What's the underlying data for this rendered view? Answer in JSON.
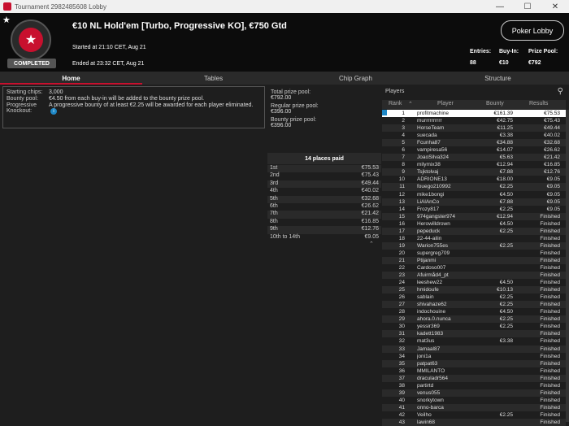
{
  "window": {
    "title": "Tournament 2982485608 Lobby",
    "min": "—",
    "max": "☐",
    "close": "✕"
  },
  "header": {
    "status": "COMPLETED",
    "title": "€10 NL Hold'em [Turbo, Progressive KO], €750 Gtd",
    "started": "Started at 21:10 CET, Aug 21",
    "ended": "Ended at 23:32 CET, Aug 21",
    "lobby_button": "Poker Lobby",
    "stats": [
      {
        "label": "Entries:",
        "value": "88"
      },
      {
        "label": "Buy-In:",
        "value": "€10"
      },
      {
        "label": "Prize Pool:",
        "value": "€792"
      }
    ]
  },
  "tabs": [
    "Home",
    "Tables",
    "Chip Graph",
    "Structure"
  ],
  "info": {
    "starting_chips_label": "Starting chips:",
    "starting_chips": "3,000",
    "bounty_pool_label": "Bounty pool:",
    "bounty_pool": "€4.50 from each buy-in will be added to the bounty prize pool.",
    "progressive_label": "Progressive Knockout:",
    "progressive": "A progressive bounty of at least €2.25 will be awarded for each player eliminated."
  },
  "prizes": {
    "total_label": "Total prize pool:",
    "total": "€792.00",
    "regular_label": "Regular prize pool:",
    "regular": "€396.00",
    "bounty_label": "Bounty prize pool:",
    "bounty": "€396.00",
    "places_header": "14 places paid",
    "places": [
      {
        "place": "1st",
        "amount": "€75.53"
      },
      {
        "place": "2nd",
        "amount": "€75.43"
      },
      {
        "place": "3rd",
        "amount": "€49.44"
      },
      {
        "place": "4th",
        "amount": "€40.02"
      },
      {
        "place": "5th",
        "amount": "€32.68"
      },
      {
        "place": "6th",
        "amount": "€26.62"
      },
      {
        "place": "7th",
        "amount": "€21.42"
      },
      {
        "place": "8th",
        "amount": "€16.85"
      },
      {
        "place": "9th",
        "amount": "€12.76"
      },
      {
        "place": "10th to 14th",
        "amount": "€9.05"
      }
    ]
  },
  "players": {
    "title": "Players",
    "columns": [
      "Rank",
      "Player",
      "Bounty",
      "Results"
    ],
    "rows": [
      [
        "1",
        "profitmachine",
        "€161.39",
        "€75.53"
      ],
      [
        "2",
        "murrrrrrrrrr",
        "€42.75",
        "€75.43"
      ],
      [
        "3",
        "HorseTeam",
        "€11.25",
        "€49.44"
      ],
      [
        "4",
        "suecada",
        "€3.38",
        "€40.02"
      ],
      [
        "5",
        "Fcunha87",
        "€34.88",
        "€32.68"
      ],
      [
        "6",
        "vampiresa56",
        "€14.07",
        "€26.62"
      ],
      [
        "7",
        "JoaoSilva324",
        "€5.63",
        "€21.42"
      ],
      [
        "8",
        "milymix38",
        "€12.94",
        "€16.85"
      ],
      [
        "9",
        "Tsjktolvaj",
        "€7.88",
        "€12.76"
      ],
      [
        "10",
        "ADRIONE13",
        "€18.00",
        "€9.05"
      ],
      [
        "11",
        "fouego210992",
        "€2.25",
        "€9.05"
      ],
      [
        "12",
        "mike1bongi",
        "€4.50",
        "€9.05"
      ],
      [
        "13",
        "LiAlAnCo",
        "€7.88",
        "€9.05"
      ],
      [
        "14",
        "Frozy817",
        "€2.25",
        "€9.05"
      ],
      [
        "15",
        "974gangster974",
        "€12.94",
        "Finished"
      ],
      [
        "16",
        "Herowilldrown",
        "€4.50",
        "Finished"
      ],
      [
        "17",
        "pepeduck",
        "€2.25",
        "Finished"
      ],
      [
        "18",
        "22-44-ailin",
        "",
        "Finished"
      ],
      [
        "19",
        "Warion755es",
        "€2.25",
        "Finished"
      ],
      [
        "20",
        "supergreg709",
        "",
        "Finished"
      ],
      [
        "21",
        "Ptijanmi",
        "",
        "Finished"
      ],
      [
        "22",
        "Cardoso007",
        "",
        "Finished"
      ],
      [
        "23",
        "Afuirmåd4_pt",
        "",
        "Finished"
      ],
      [
        "24",
        "leeshew22",
        "€4.50",
        "Finished"
      ],
      [
        "25",
        "hmidoufe",
        "€10.13",
        "Finished"
      ],
      [
        "26",
        "sablain",
        "€2.25",
        "Finished"
      ],
      [
        "27",
        "shivahaze62",
        "€2.25",
        "Finished"
      ],
      [
        "28",
        "indochouine",
        "€4.50",
        "Finished"
      ],
      [
        "29",
        "ahora.0.nunca",
        "€2.25",
        "Finished"
      ],
      [
        "30",
        "yessir369",
        "€2.25",
        "Finished"
      ],
      [
        "31",
        "kadett1983",
        "",
        "Finished"
      ],
      [
        "32",
        "mat3us",
        "€3.38",
        "Finished"
      ],
      [
        "33",
        "Jamaal87",
        "",
        "Finished"
      ],
      [
        "34",
        "joni1a",
        "",
        "Finished"
      ],
      [
        "35",
        "patpat63",
        "",
        "Finished"
      ],
      [
        "36",
        "MMILANTO",
        "",
        "Finished"
      ],
      [
        "37",
        "draculadr564",
        "",
        "Finished"
      ],
      [
        "38",
        "partirtd",
        "",
        "Finished"
      ],
      [
        "39",
        "venus055",
        "",
        "Finished"
      ],
      [
        "40",
        "snorkytown",
        "",
        "Finished"
      ],
      [
        "41",
        "onno-barca",
        "",
        "Finished"
      ],
      [
        "42",
        "Veilho",
        "€2.25",
        "Finished"
      ],
      [
        "43",
        "lawin68",
        "",
        "Finished"
      ]
    ]
  }
}
